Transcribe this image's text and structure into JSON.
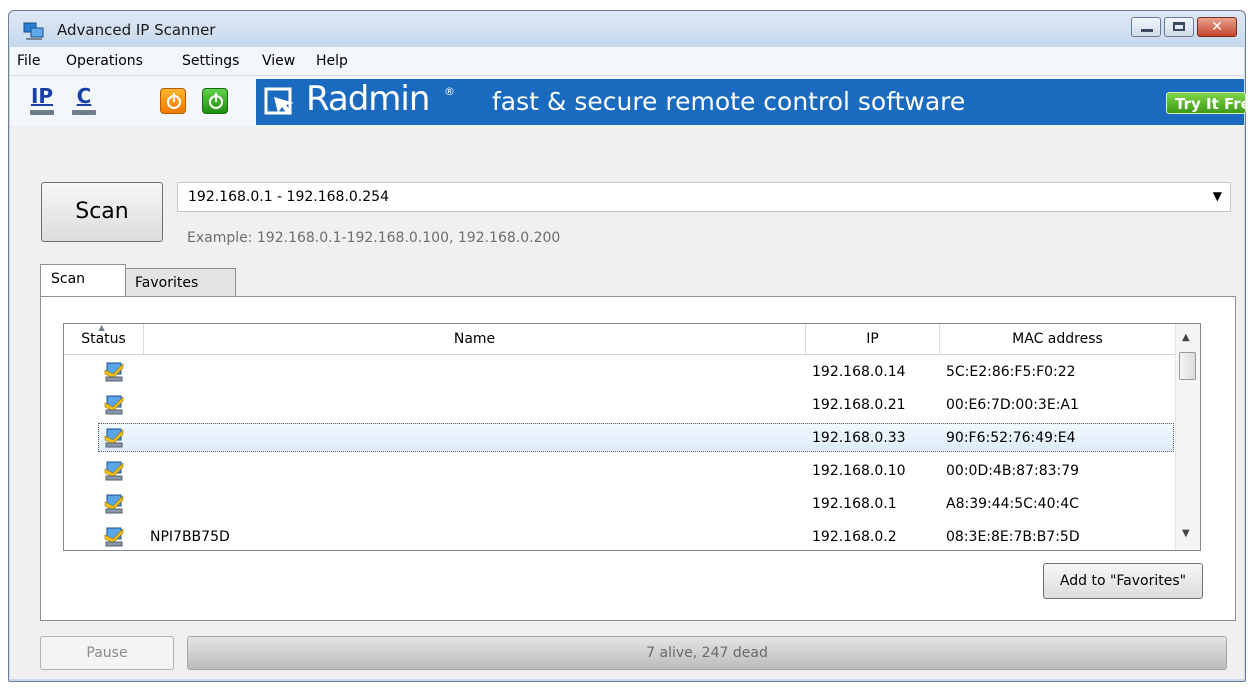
{
  "window": {
    "title": "Advanced IP Scanner",
    "app_icon": "network-computers-icon",
    "controls": [
      "minimize-icon",
      "maximize-icon",
      "close-icon"
    ]
  },
  "menu": [
    "File",
    "Operations",
    "Settings",
    "View",
    "Help"
  ],
  "toolbar": {
    "ip_label": "IP",
    "c_label": "C",
    "icons": [
      "ip-scan-icon",
      "class-c-icon",
      "power-off-orange-icon",
      "power-on-green-icon"
    ],
    "ad": {
      "brand": "Radmin",
      "reg": "®",
      "tagline": "fast & secure remote control software",
      "cta": "Try It Free"
    }
  },
  "scan": {
    "button_label": "Scan",
    "range_value": "192.168.0.1 - 192.168.0.254",
    "example": "Example: 192.168.0.1-192.168.0.100, 192.168.0.200"
  },
  "tabs": [
    {
      "label": "Scan",
      "active": true
    },
    {
      "label": "Favorites",
      "active": false
    }
  ],
  "table": {
    "columns": [
      "Status",
      "Name",
      "IP",
      "MAC address"
    ],
    "rows": [
      {
        "name": "",
        "ip": "192.168.0.14",
        "mac": "5C:E2:86:F5:F0:22"
      },
      {
        "name": "",
        "ip": "192.168.0.21",
        "mac": "00:E6:7D:00:3E:A1"
      },
      {
        "name": "",
        "ip": "192.168.0.33",
        "mac": "90:F6:52:76:49:E4",
        "selected": true
      },
      {
        "name": "",
        "ip": "192.168.0.10",
        "mac": "00:0D:4B:87:83:79"
      },
      {
        "name": "",
        "ip": "192.168.0.1",
        "mac": "A8:39:44:5C:40:4C"
      },
      {
        "name": "NPI7BB75D",
        "ip": "192.168.0.2",
        "mac": "08:3E:8E:7B:B7:5D"
      }
    ]
  },
  "add_favorites_label": "Add to \"Favorites\"",
  "footer": {
    "pause_label": "Pause",
    "status": "7 alive, 247 dead",
    "progress": 1.0
  }
}
